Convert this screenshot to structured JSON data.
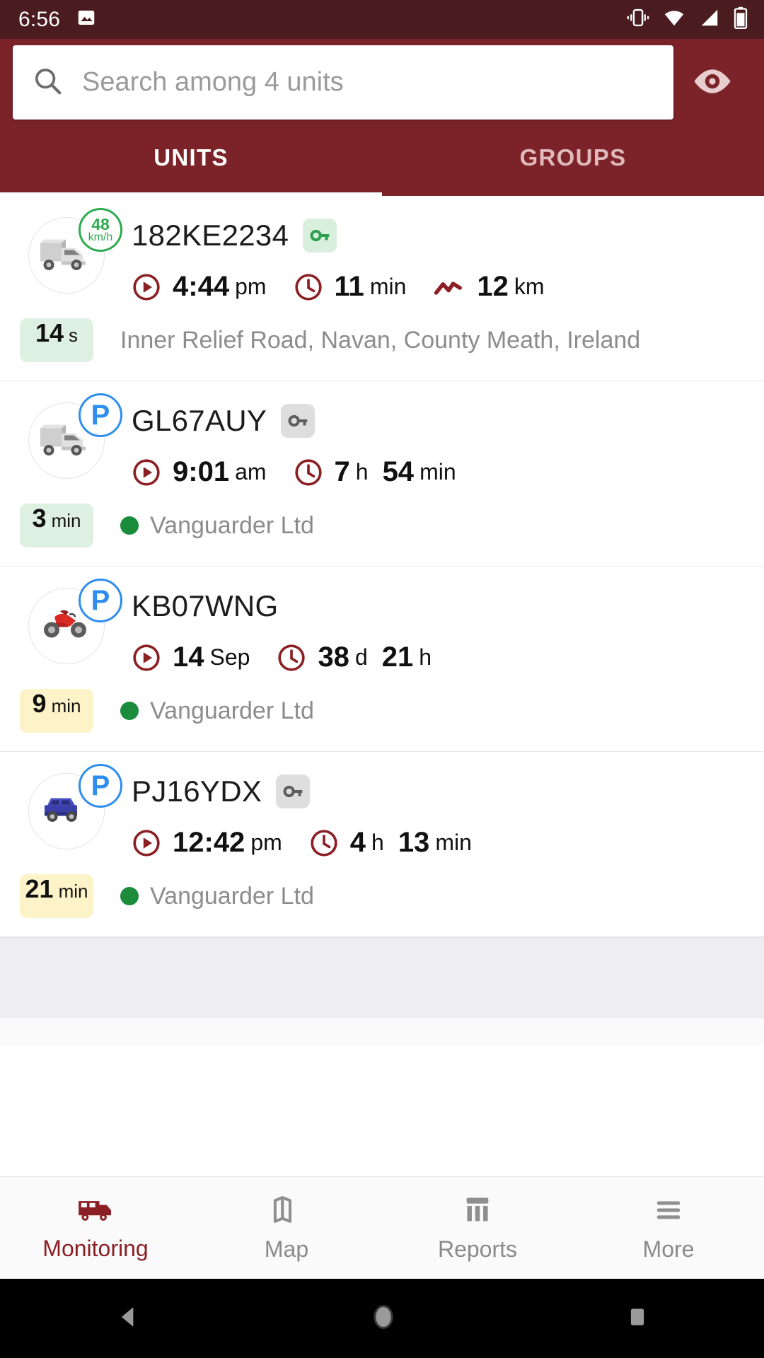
{
  "statusbar": {
    "time": "6:56",
    "icons": [
      "image-icon",
      "vibrate-icon",
      "wifi-icon",
      "signal-icon",
      "battery-icon"
    ]
  },
  "search": {
    "placeholder": "Search among 4 units",
    "value": "",
    "icon": "search-icon",
    "visibility_icon": "eye-icon"
  },
  "tabs": [
    {
      "label": "UNITS",
      "active": true
    },
    {
      "label": "GROUPS",
      "active": false
    }
  ],
  "colors": {
    "appbar": "#7b2328",
    "statusbar": "#4a1c1f",
    "accent": "#8b2024",
    "moving": "#2eab50",
    "parked": "#2e8ded",
    "online_dot": "#1a8c3c",
    "badge_green": "#ddf0e1",
    "badge_yellow": "#fdf3c9"
  },
  "units": [
    {
      "name": "182KE2234",
      "vehicle": "truck-gray",
      "state": "moving",
      "speed_value": "48",
      "speed_unit": "km/h",
      "ignition": "on",
      "stats": [
        {
          "icon": "play-circle-icon",
          "value": "4:44",
          "unit": "pm"
        },
        {
          "icon": "clock-icon",
          "value": "11",
          "unit": "min"
        },
        {
          "icon": "mileage-icon",
          "value": "12",
          "unit": "km"
        }
      ],
      "duration_value": "14",
      "duration_unit": "s",
      "duration_color": "green",
      "bottom_text": "Inner Relief Road, Navan, County Meath, Ireland",
      "bottom_has_dot": false
    },
    {
      "name": "GL67AUY",
      "vehicle": "truck-gray",
      "state": "parked",
      "speed_value": "P",
      "speed_unit": "",
      "ignition": "off",
      "stats": [
        {
          "icon": "play-circle-icon",
          "value": "9:01",
          "unit": "am"
        },
        {
          "icon": "clock-icon",
          "value": "7",
          "unit": "h",
          "value2": "54",
          "unit2": "min"
        }
      ],
      "duration_value": "3",
      "duration_unit": "min",
      "duration_color": "green",
      "bottom_text": "Vanguarder Ltd",
      "bottom_has_dot": true
    },
    {
      "name": "KB07WNG",
      "vehicle": "motorcycle-red",
      "state": "parked",
      "speed_value": "P",
      "speed_unit": "",
      "ignition": "none",
      "stats": [
        {
          "icon": "play-circle-icon",
          "value": "14",
          "unit": "Sep"
        },
        {
          "icon": "clock-icon",
          "value": "38",
          "unit": "d",
          "value2": "21",
          "unit2": "h"
        }
      ],
      "duration_value": "9",
      "duration_unit": "min",
      "duration_color": "yellow",
      "bottom_text": "Vanguarder Ltd",
      "bottom_has_dot": true
    },
    {
      "name": "PJ16YDX",
      "vehicle": "car-blue",
      "state": "parked",
      "speed_value": "P",
      "speed_unit": "",
      "ignition": "off",
      "stats": [
        {
          "icon": "play-circle-icon",
          "value": "12:42",
          "unit": "pm"
        },
        {
          "icon": "clock-icon",
          "value": "4",
          "unit": "h",
          "value2": "13",
          "unit2": "min"
        }
      ],
      "duration_value": "21",
      "duration_unit": "min",
      "duration_color": "yellow",
      "bottom_text": "Vanguarder Ltd",
      "bottom_has_dot": true
    }
  ],
  "bottomnav": [
    {
      "label": "Monitoring",
      "icon": "van-icon",
      "active": true
    },
    {
      "label": "Map",
      "icon": "map-icon",
      "active": false
    },
    {
      "label": "Reports",
      "icon": "reports-icon",
      "active": false
    },
    {
      "label": "More",
      "icon": "hamburger-icon",
      "active": false
    }
  ],
  "androidnav": [
    {
      "icon": "back-icon"
    },
    {
      "icon": "home-icon"
    },
    {
      "icon": "recents-icon"
    }
  ]
}
